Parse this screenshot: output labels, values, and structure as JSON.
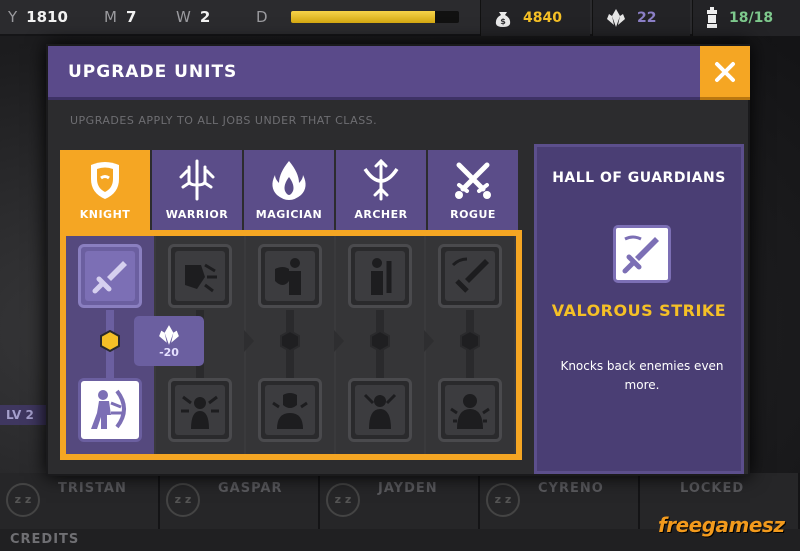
{
  "topbar": {
    "y": {
      "key": "Y",
      "value": "1810"
    },
    "m": {
      "key": "M",
      "value": "7"
    },
    "w": {
      "key": "W",
      "value": "2"
    },
    "d": {
      "key": "D",
      "fill": 0.86
    },
    "coins": {
      "value": "4840",
      "icon": "money-bag-icon",
      "color": "#f5c026"
    },
    "gems": {
      "value": "22",
      "icon": "crystal-icon",
      "color": "#8b7fc6"
    },
    "population": {
      "value": "18/18",
      "icon": "lantern-icon",
      "color": "#7ec98d"
    }
  },
  "modal": {
    "title": "UPGRADE UNITS",
    "subtitle": "UPGRADES APPLY TO ALL JOBS UNDER THAT CLASS.",
    "close_icon": "close-icon",
    "tabs": [
      {
        "label": "KNIGHT",
        "icon": "shield-icon",
        "active": true
      },
      {
        "label": "WARRIOR",
        "icon": "trident-icon",
        "active": false
      },
      {
        "label": "MAGICIAN",
        "icon": "flame-icon",
        "active": false
      },
      {
        "label": "ARCHER",
        "icon": "bow-icon",
        "active": false
      },
      {
        "label": "ROGUE",
        "icon": "crossed-daggers-icon",
        "active": false
      }
    ],
    "upgrade_cost": "-20",
    "info": {
      "hall": "HALL OF GUARDIANS",
      "skill_name": "VALOROUS STRIKE",
      "skill_desc": "Knocks back enemies even more."
    }
  },
  "roster": [
    {
      "name": "TRISTAN"
    },
    {
      "name": "GASPAR"
    },
    {
      "name": "JAYDEN"
    },
    {
      "name": "CYRENO"
    },
    {
      "name": "LOCKED"
    }
  ],
  "level_badge": "LV 2",
  "credits_label": "CREDITS",
  "watermark": "freegamesz",
  "colors": {
    "accent": "#f5a623",
    "purple": "#5a4a8a",
    "gold_text": "#f5c026"
  }
}
